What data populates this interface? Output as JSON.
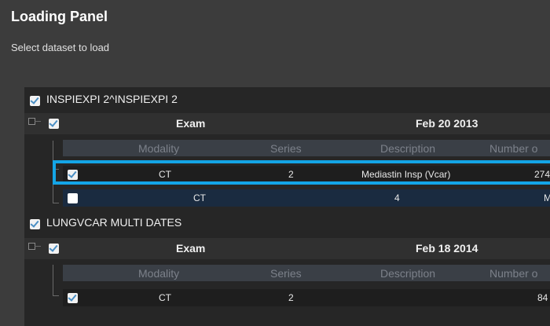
{
  "panel": {
    "title": "Loading Panel",
    "subtitle": "Select dataset to load"
  },
  "columns": {
    "modality": "Modality",
    "series": "Series",
    "description": "Description",
    "number": "Number o"
  },
  "patients": [
    {
      "name": "INSPIEXPI 2^INSPIEXPI 2",
      "checked": true,
      "exam": {
        "label": "Exam",
        "date": "Feb 20 2013",
        "checked": true
      },
      "series": [
        {
          "modality": "CT",
          "series": "2",
          "description": "Mediastin Insp (Vcar)",
          "number": "274",
          "checked": true,
          "selected": true
        },
        {
          "modality": "CT",
          "series": "4",
          "description": "",
          "number": "M",
          "checked": false,
          "selected": false
        }
      ]
    },
    {
      "name": "LUNGVCAR MULTI DATES",
      "checked": true,
      "exam": {
        "label": "Exam",
        "date": "Feb 18 2014",
        "checked": true
      },
      "series": [
        {
          "modality": "CT",
          "series": "2",
          "description": "",
          "number": "84",
          "checked": true,
          "selected": false
        }
      ]
    }
  ],
  "colors": {
    "background": "#3c3c3c",
    "selection_border": "#14a5e6",
    "row_highlight": "#1a2b40"
  }
}
